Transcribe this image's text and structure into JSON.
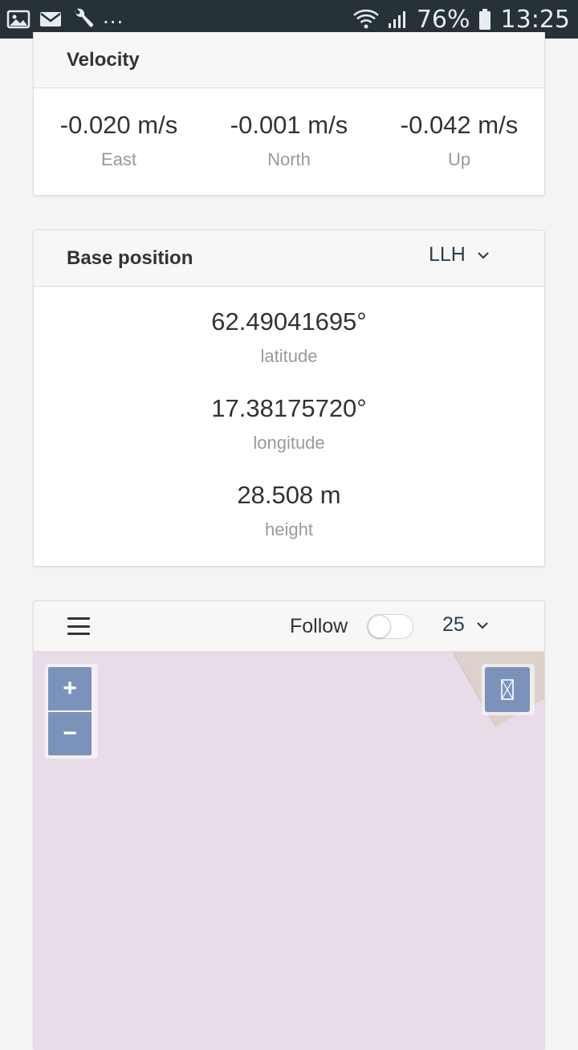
{
  "statusbar": {
    "left_icons": [
      "image-icon",
      "mail-icon",
      "wrench-icon"
    ],
    "overflow": "...",
    "battery": "76%",
    "time": "13:25"
  },
  "velocity": {
    "title": "Velocity",
    "items": [
      {
        "value": "-0.020 m/s",
        "label": "East"
      },
      {
        "value": "-0.001 m/s",
        "label": "North"
      },
      {
        "value": "-0.042 m/s",
        "label": "Up"
      }
    ]
  },
  "base_position": {
    "title": "Base position",
    "format": "LLH",
    "items": [
      {
        "value": "62.49041695°",
        "label": "latitude"
      },
      {
        "value": "17.38175720°",
        "label": "longitude"
      },
      {
        "value": "28.508 m",
        "label": "height"
      }
    ]
  },
  "map": {
    "follow_label": "Follow",
    "follow_enabled": false,
    "zoom_level": "25",
    "zoom_in": "+",
    "zoom_out": "−",
    "colors": {
      "map_background": "#e8dce9",
      "building": "#ddd1cc",
      "control_button": "#7b93bb"
    }
  }
}
